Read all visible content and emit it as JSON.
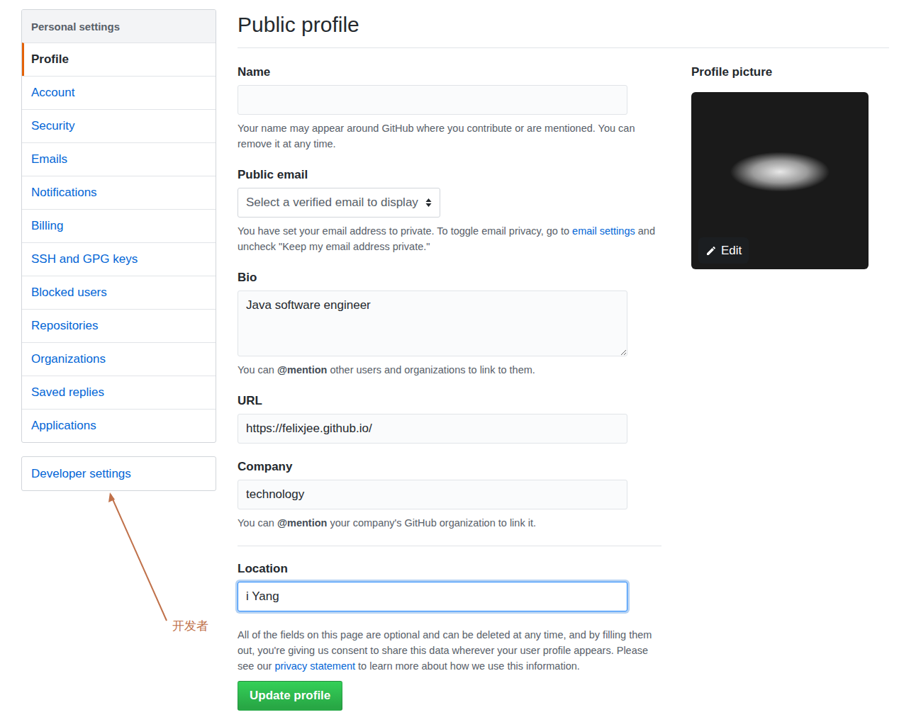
{
  "sidebar": {
    "header": "Personal settings",
    "items": [
      {
        "label": "Profile",
        "selected": true
      },
      {
        "label": "Account",
        "selected": false
      },
      {
        "label": "Security",
        "selected": false
      },
      {
        "label": "Emails",
        "selected": false
      },
      {
        "label": "Notifications",
        "selected": false
      },
      {
        "label": "Billing",
        "selected": false
      },
      {
        "label": "SSH and GPG keys",
        "selected": false
      },
      {
        "label": "Blocked users",
        "selected": false
      },
      {
        "label": "Repositories",
        "selected": false
      },
      {
        "label": "Organizations",
        "selected": false
      },
      {
        "label": "Saved replies",
        "selected": false
      },
      {
        "label": "Applications",
        "selected": false
      }
    ],
    "footer_item": {
      "label": "Developer settings",
      "selected": false
    }
  },
  "annotation": {
    "text": "开发者"
  },
  "page": {
    "title": "Public profile"
  },
  "form": {
    "fields": [
      {
        "kind": "input",
        "label": "Name",
        "value": "",
        "focused": false,
        "divider": false,
        "note": [
          {
            "kind": "plain",
            "text": "Your name may appear around GitHub where you contribute or are mentioned. You can remove it at any time."
          }
        ]
      },
      {
        "kind": "select",
        "label": "Public email",
        "value": "Select a verified email to display",
        "focused": false,
        "divider": false,
        "note": [
          {
            "kind": "plain",
            "text": "You have set your email address to private. To toggle email privacy, go to "
          },
          {
            "kind": "link",
            "text": "email settings"
          },
          {
            "kind": "plain",
            "text": " and uncheck \"Keep my email address private.\""
          }
        ]
      },
      {
        "kind": "textarea",
        "label": "Bio",
        "value": "Java software engineer",
        "focused": false,
        "divider": false,
        "note": [
          {
            "kind": "plain",
            "text": "You can "
          },
          {
            "kind": "bold",
            "text": "@mention"
          },
          {
            "kind": "plain",
            "text": " other users and organizations to link to them."
          }
        ]
      },
      {
        "kind": "input",
        "label": "URL",
        "value": "https://felixjee.github.io/",
        "focused": false,
        "divider": false,
        "note": []
      },
      {
        "kind": "input",
        "label": "Company",
        "value": "technology",
        "focused": false,
        "divider": false,
        "note": [
          {
            "kind": "plain",
            "text": "You can "
          },
          {
            "kind": "bold",
            "text": "@mention"
          },
          {
            "kind": "plain",
            "text": " your company's GitHub organization to link it."
          }
        ]
      },
      {
        "kind": "input",
        "label": "Location",
        "value": "i Yang",
        "focused": true,
        "divider": true,
        "note": []
      }
    ],
    "disclaimer": [
      {
        "kind": "plain",
        "text": "All of the fields on this page are optional and can be deleted at any time, and by filling them out, you're giving us consent to share this data wherever your user profile appears. Please see our "
      },
      {
        "kind": "link",
        "text": "privacy statement"
      },
      {
        "kind": "plain",
        "text": " to learn more about how we use this information."
      }
    ],
    "submit": "Update profile"
  },
  "picture": {
    "label": "Profile picture",
    "edit": "Edit"
  }
}
